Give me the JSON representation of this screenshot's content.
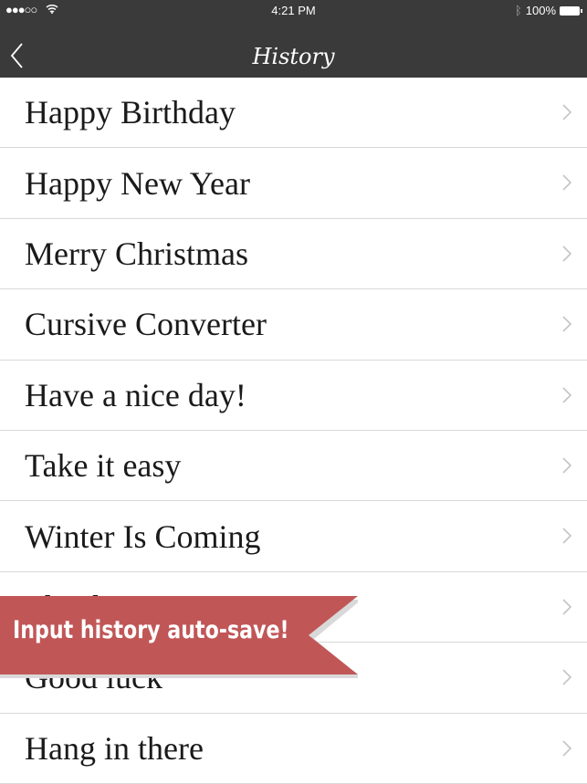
{
  "status_bar": {
    "signal": "●●●○○",
    "time": "4:21 PM",
    "battery": "100%"
  },
  "nav": {
    "title": "History",
    "back_icon": "chevron-left-icon"
  },
  "items": [
    {
      "label": "Happy Birthday"
    },
    {
      "label": "Happy New Year"
    },
    {
      "label": "Merry Christmas"
    },
    {
      "label": "Cursive Converter"
    },
    {
      "label": "Have a nice day!"
    },
    {
      "label": "Take it easy"
    },
    {
      "label": "Winter Is Coming"
    },
    {
      "label": "Thank you"
    },
    {
      "label": "Good luck"
    },
    {
      "label": "Hang in there"
    }
  ],
  "banner": {
    "text": "Input history auto-save!",
    "color": "#c15657"
  },
  "colors": {
    "header": "#3a3a3a"
  }
}
